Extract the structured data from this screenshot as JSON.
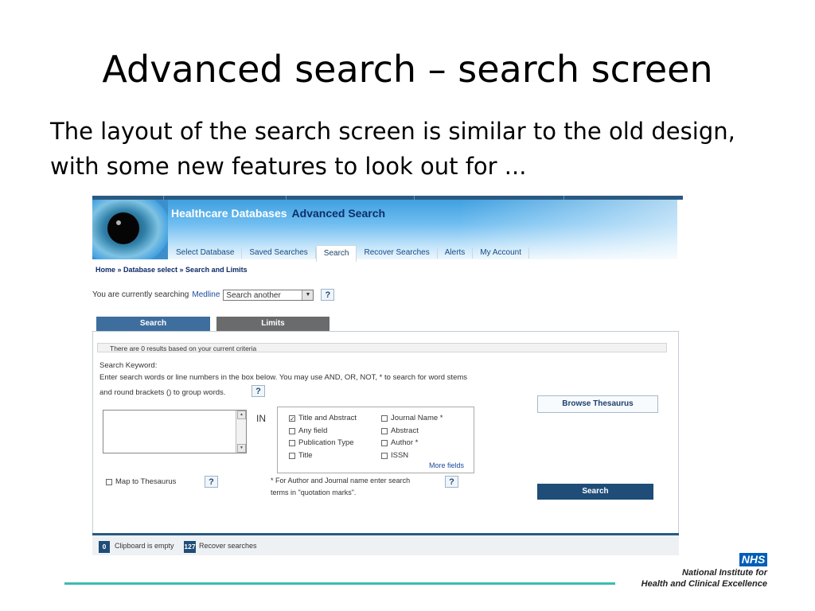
{
  "slide": {
    "title": "Advanced search – search screen",
    "body": "The layout of the search screen is similar to the old design, with some new features to look out for ..."
  },
  "app": {
    "title": "Healthcare Databases",
    "subtitle": "Advanced Search"
  },
  "nav": {
    "items": [
      {
        "label": "Select Database"
      },
      {
        "label": "Saved Searches"
      },
      {
        "label": "Search"
      },
      {
        "label": "Recover Searches"
      },
      {
        "label": "Alerts"
      },
      {
        "label": "My Account"
      }
    ],
    "active": "Search"
  },
  "breadcrumb": "Home » Database select » Search and Limits",
  "currently_searching": {
    "prefix": "You are currently searching",
    "database": "Medline",
    "select_value": "Search another",
    "help": "?"
  },
  "tabs": [
    {
      "label": "Search"
    },
    {
      "label": "Limits"
    }
  ],
  "results_text": "There are  0 results based on your current criteria",
  "keyword": {
    "label": "Search Keyword:",
    "help_line1": "Enter search words or line numbers in the box below. You may use AND, OR, NOT, * to search for word stems",
    "help_line2": "and round brackets () to group words.",
    "help_button": "?"
  },
  "in_label": "IN",
  "fields": [
    {
      "label": "Title and Abstract",
      "checked": true
    },
    {
      "label": "Journal Name *",
      "checked": false
    },
    {
      "label": "Any field",
      "checked": false
    },
    {
      "label": "Abstract",
      "checked": false
    },
    {
      "label": "Publication Type",
      "checked": false
    },
    {
      "label": "Author *",
      "checked": false
    },
    {
      "label": "Title",
      "checked": false
    },
    {
      "label": "ISSN",
      "checked": false
    }
  ],
  "more_fields": "More fields",
  "browse_thesaurus": "Browse Thesaurus",
  "map_to_thesaurus": {
    "label": "Map to Thesaurus",
    "help": "?"
  },
  "author_note": {
    "line1": "* For Author and Journal name enter search",
    "line2": "terms in \"quotation marks\".",
    "help": "?"
  },
  "search_button": "Search",
  "bottom_bar": {
    "clipboard_count": "0",
    "clipboard_text": "Clipboard is empty",
    "recover_count": "127",
    "recover_text": "Recover searches"
  },
  "logo": {
    "nhs": "NHS",
    "org_line1": "National Institute for",
    "org_line2": "Health and Clinical Excellence"
  },
  "colors": {
    "header_blue": "#2a5a82",
    "button_blue": "#1f4d78",
    "tab_search": "#3e6e9e",
    "tab_limits": "#6b6b6b",
    "accent_rule": "#3cbcb0",
    "nhs_blue": "#005eb8"
  }
}
